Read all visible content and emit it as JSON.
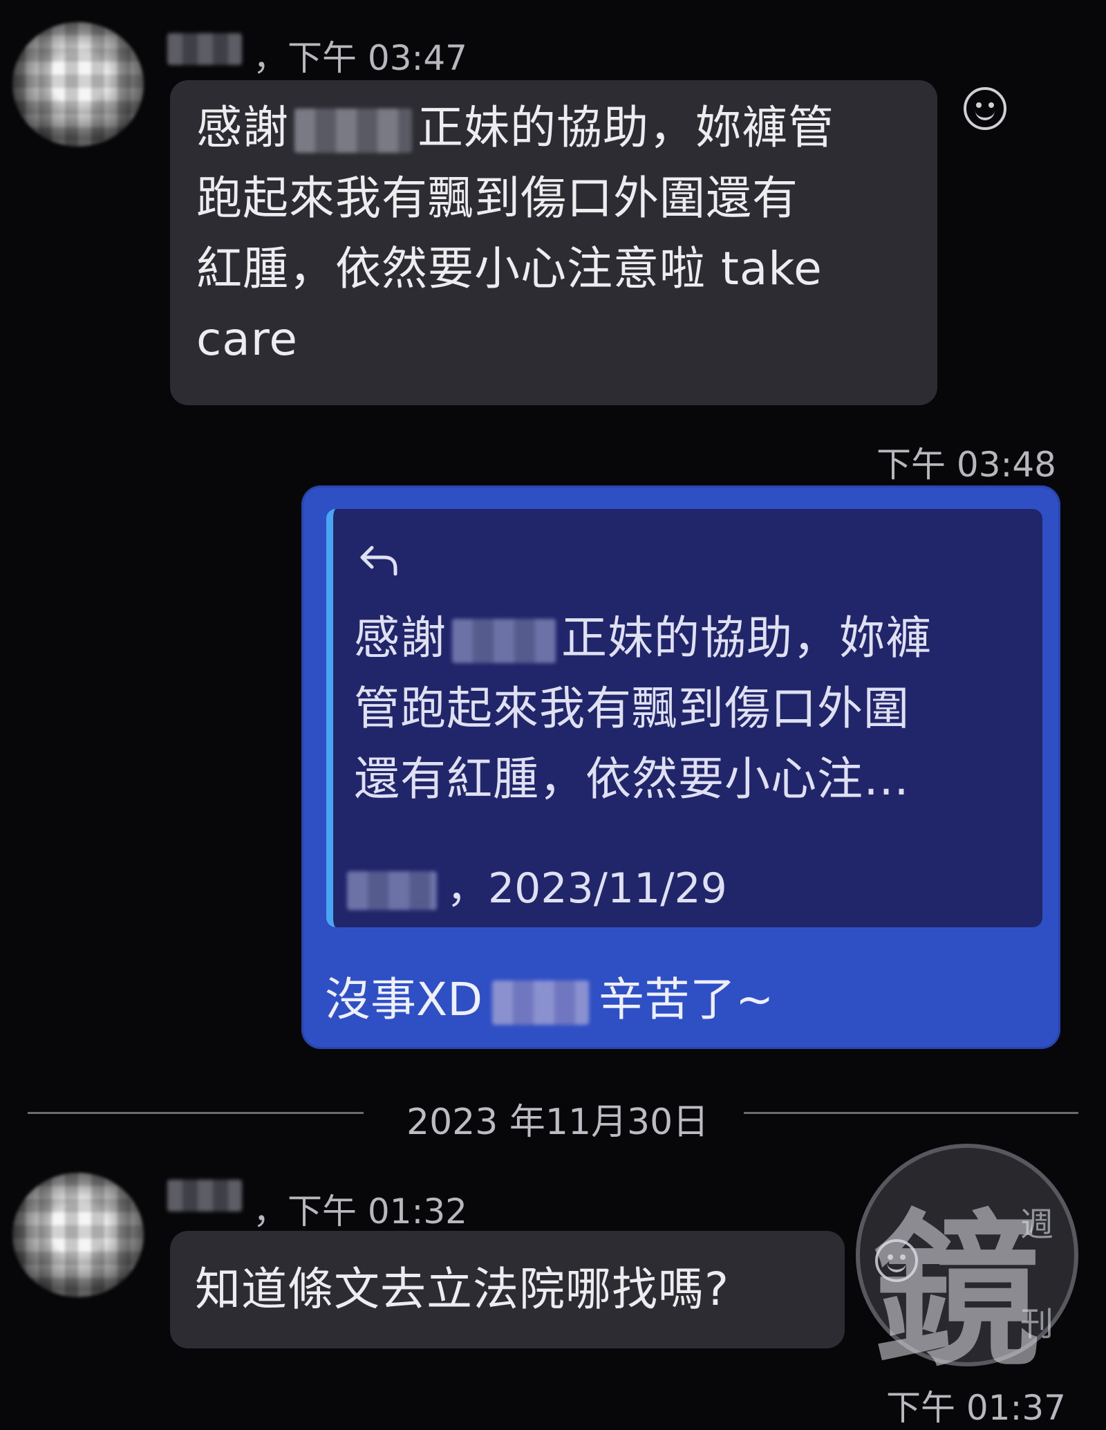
{
  "messages": [
    {
      "meta_time": "，下午 03:47",
      "text_lines": [
        "感謝",
        "正妹的協助，妳褲管",
        "跑起來我有飄到傷口外圍還有",
        "紅腫，依然要小心注意啦 take",
        "care"
      ]
    },
    {
      "time": "下午 03:48",
      "quote": {
        "lines": [
          "感謝",
          "正妹的協助，妳褲",
          "管跑起來我有飄到傷口外圍",
          "還有紅腫，依然要小心注…"
        ],
        "meta": "，2023/11/29"
      },
      "reply_prefix": "沒事XD",
      "reply_suffix": "辛苦了~"
    },
    {
      "meta_time": "，下午 01:32",
      "text": "知道條文去立法院哪找嗎?"
    }
  ],
  "date_divider": "2023 年11月30日",
  "last_time": "下午 01:37",
  "watermark": {
    "main": "鏡",
    "small1": "週",
    "small2": "刊"
  },
  "icons": [
    "smile-icon",
    "reply-arrow-icon",
    "smile-icon"
  ]
}
